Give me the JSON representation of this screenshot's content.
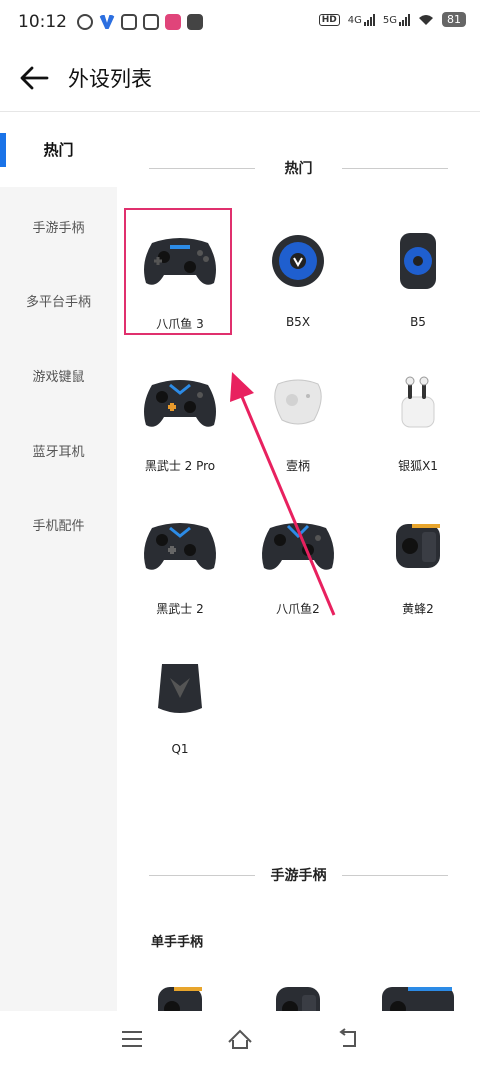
{
  "status_bar": {
    "time": "10:12",
    "hd_badge": "HD",
    "net1": "4G",
    "net2": "5G",
    "battery": "81"
  },
  "header": {
    "title": "外设列表"
  },
  "sidebar": {
    "items": [
      {
        "label": "热门",
        "active": true
      },
      {
        "label": "手游手柄"
      },
      {
        "label": "多平台手柄"
      },
      {
        "label": "游戏键鼠"
      },
      {
        "label": "蓝牙耳机"
      },
      {
        "label": "手机配件"
      }
    ]
  },
  "sections": [
    {
      "title": "热门",
      "products": [
        {
          "name": "八爪鱼 3",
          "icon": "gamepad-icon",
          "selected": true
        },
        {
          "name": "B5X",
          "icon": "phone-cooler-icon"
        },
        {
          "name": "B5",
          "icon": "phone-cooler-icon"
        },
        {
          "name": "黑武士 2 Pro",
          "icon": "gamepad-icon"
        },
        {
          "name": "壹柄",
          "icon": "mini-controller-icon"
        },
        {
          "name": "银狐X1",
          "icon": "earbuds-icon"
        },
        {
          "name": "黑武士 2",
          "icon": "gamepad-icon"
        },
        {
          "name": "八爪鱼2",
          "icon": "gamepad-icon"
        },
        {
          "name": "黄蜂2",
          "icon": "one-hand-controller-icon"
        },
        {
          "name": "Q1",
          "icon": "receiver-icon"
        }
      ]
    },
    {
      "title": "手游手柄",
      "subsections": [
        {
          "title": "单手手柄"
        }
      ]
    }
  ],
  "colors": {
    "accent": "#1a73e8",
    "highlight": "#e0306d"
  }
}
